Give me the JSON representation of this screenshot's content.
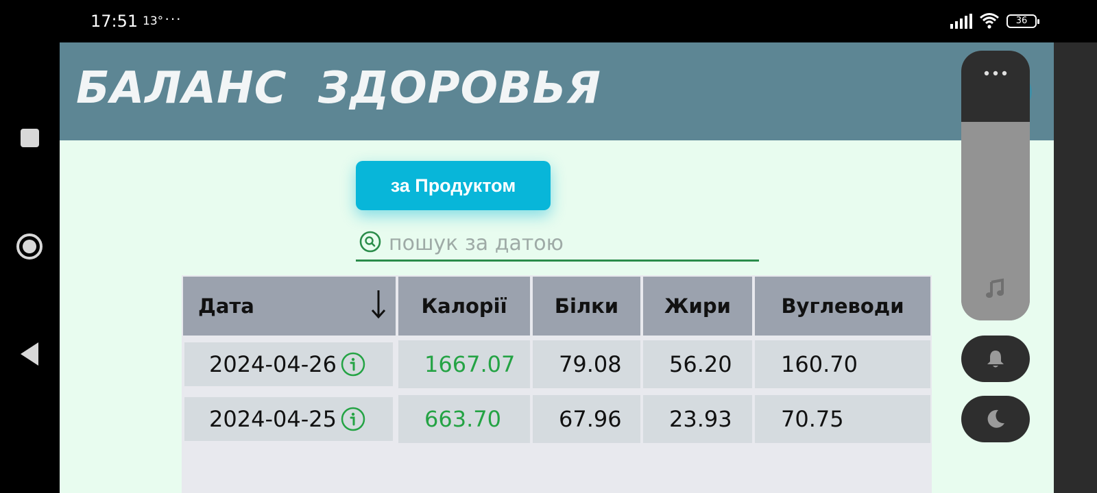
{
  "status_bar": {
    "time": "17:51",
    "temperature": "13°",
    "more": "···",
    "battery": "36"
  },
  "header": {
    "title": "БАЛАНС ЗДОРОВЬЯ"
  },
  "toolbar": {
    "by_product_label": "за Продуктом"
  },
  "search": {
    "placeholder": "пошук за датою",
    "value": ""
  },
  "table": {
    "columns": [
      "Дата",
      "Калорії",
      "Білки",
      "Жири",
      "Вуглеводи"
    ],
    "sort": "descending",
    "rows": [
      {
        "date": "2024-04-26",
        "calories": "1667.07",
        "protein": "79.08",
        "fat": "56.20",
        "carbs": "160.70"
      },
      {
        "date": "2024-04-25",
        "calories": "663.70",
        "protein": "67.96",
        "fat": "23.93",
        "carbs": "70.75"
      }
    ]
  },
  "colors": {
    "header_bg": "#5d8694",
    "page_bg": "#e8fcef",
    "accent_button": "#08b6d9",
    "calories_text": "#24a344",
    "search_underline": "#2a8c4a",
    "table_header": "#9ba2ae",
    "table_cell": "#d5dbdf"
  },
  "icons": {
    "search": "search-icon",
    "sort": "arrow-down-icon",
    "info": "info-icon",
    "panel_more": "more-icon",
    "panel_music": "music-note-icon",
    "panel_bell": "bell-icon",
    "panel_moon": "moon-icon"
  }
}
